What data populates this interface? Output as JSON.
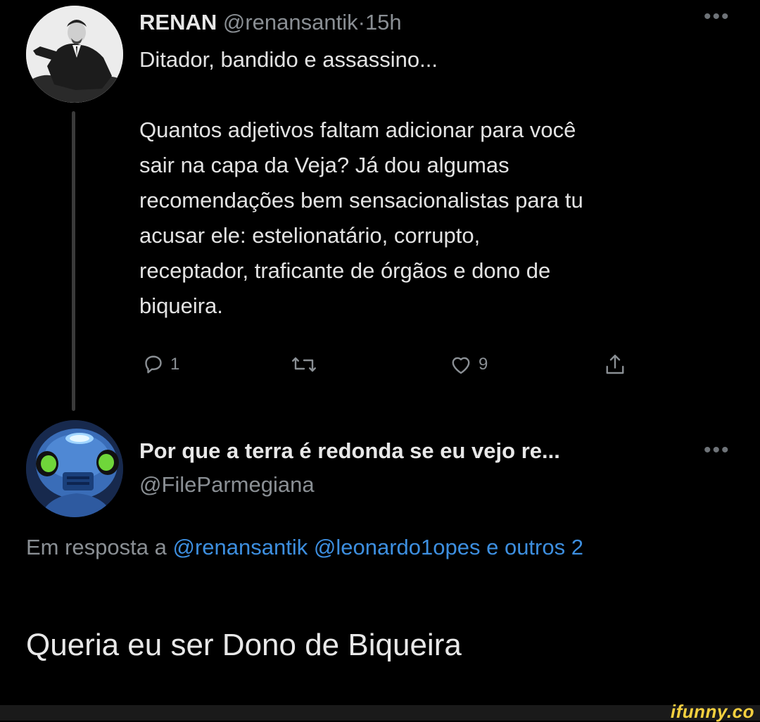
{
  "tweet": {
    "author_name": "RENAN",
    "author_handle": "@renansantik",
    "separator": "·",
    "time": "15h",
    "more_icon": "more-dots-icon",
    "text": "Ditador, bandido e assassino...\n\nQuantos adjetivos faltam adicionar para você\nsair na capa da Veja? Já dou algumas\nrecomendações bem sensacionalistas para tu\nacusar ele: estelionatário, corrupto,\nreceptador, traficante de órgãos e dono de\nbiqueira.",
    "actions": {
      "reply_icon": "reply-icon",
      "reply_count": "1",
      "retweet_icon": "retweet-icon",
      "like_icon": "heart-icon",
      "like_count": "9",
      "share_icon": "share-icon"
    }
  },
  "reply": {
    "author_name": "Por que a terra é redonda se eu vejo re...",
    "author_handle": "@FileParmegiana",
    "more_icon": "more-dots-icon",
    "context_prefix": "Em resposta a",
    "mention_1": "@renansantik",
    "mention_2": "@leonardo1opes",
    "others": "e outros 2",
    "text": "Queria eu ser Dono de Biqueira"
  },
  "watermark": {
    "text": "ifunny.co"
  },
  "colors": {
    "background": "#000000",
    "text": "#e3e3e3",
    "muted": "#8a8f94",
    "link": "#3d8fe0",
    "watermark": "#f4d03f"
  }
}
